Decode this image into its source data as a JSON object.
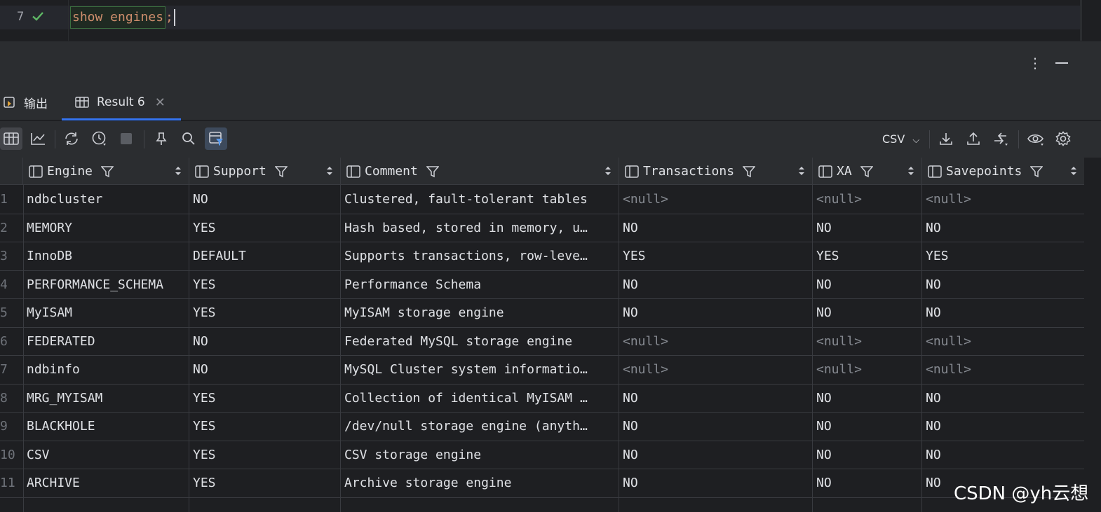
{
  "editor": {
    "line_number": "7",
    "code_keyword": "show engines",
    "code_punct": ";"
  },
  "tabs": [
    {
      "label": "输出",
      "icon": "output-icon"
    },
    {
      "label": "Result 6",
      "icon": "table-icon",
      "closable": true
    }
  ],
  "toolbar": {
    "export_format": "CSV"
  },
  "grid": {
    "columns": [
      "Engine",
      "Support",
      "Comment",
      "Transactions",
      "XA",
      "Savepoints"
    ],
    "rows": [
      {
        "n": "1",
        "engine": "ndbcluster",
        "support": "NO",
        "comment": "Clustered, fault-tolerant tables",
        "transactions": "<null>",
        "xa": "<null>",
        "savepoints": "<null>"
      },
      {
        "n": "2",
        "engine": "MEMORY",
        "support": "YES",
        "comment": "Hash based, stored in memory, u…",
        "transactions": "NO",
        "xa": "NO",
        "savepoints": "NO"
      },
      {
        "n": "3",
        "engine": "InnoDB",
        "support": "DEFAULT",
        "comment": "Supports transactions, row-leve…",
        "transactions": "YES",
        "xa": "YES",
        "savepoints": "YES"
      },
      {
        "n": "4",
        "engine": "PERFORMANCE_SCHEMA",
        "support": "YES",
        "comment": "Performance Schema",
        "transactions": "NO",
        "xa": "NO",
        "savepoints": "NO"
      },
      {
        "n": "5",
        "engine": "MyISAM",
        "support": "YES",
        "comment": "MyISAM storage engine",
        "transactions": "NO",
        "xa": "NO",
        "savepoints": "NO"
      },
      {
        "n": "6",
        "engine": "FEDERATED",
        "support": "NO",
        "comment": "Federated MySQL storage engine",
        "transactions": "<null>",
        "xa": "<null>",
        "savepoints": "<null>"
      },
      {
        "n": "7",
        "engine": "ndbinfo",
        "support": "NO",
        "comment": "MySQL Cluster system informatio…",
        "transactions": "<null>",
        "xa": "<null>",
        "savepoints": "<null>"
      },
      {
        "n": "8",
        "engine": "MRG_MYISAM",
        "support": "YES",
        "comment": "Collection of identical MyISAM …",
        "transactions": "NO",
        "xa": "NO",
        "savepoints": "NO"
      },
      {
        "n": "9",
        "engine": "BLACKHOLE",
        "support": "YES",
        "comment": "/dev/null storage engine (anyth…",
        "transactions": "NO",
        "xa": "NO",
        "savepoints": "NO"
      },
      {
        "n": "10",
        "engine": "CSV",
        "support": "YES",
        "comment": "CSV storage engine",
        "transactions": "NO",
        "xa": "NO",
        "savepoints": "NO"
      },
      {
        "n": "11",
        "engine": "ARCHIVE",
        "support": "YES",
        "comment": "Archive storage engine",
        "transactions": "NO",
        "xa": "NO",
        "savepoints": "NO"
      }
    ]
  },
  "watermark": "CSDN @yh云想"
}
